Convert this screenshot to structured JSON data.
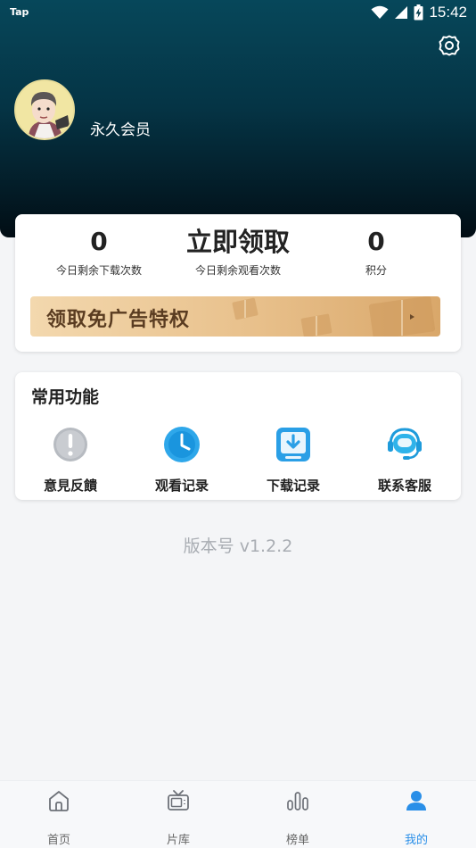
{
  "status_bar": {
    "app_label": "Tap",
    "time": "15:42"
  },
  "profile": {
    "membership": "永久会员"
  },
  "stats": {
    "download_count": "0",
    "download_label": "今日剩余下载次数",
    "claim_label": "立即领取",
    "watch_label": "今日剩余观看次数",
    "points_value": "0",
    "points_label": "积分"
  },
  "banner": {
    "text": "领取免广告特权"
  },
  "functions": {
    "title": "常用功能",
    "items": [
      {
        "label": "意見反饋",
        "icon": "exclamation-icon"
      },
      {
        "label": "观看记录",
        "icon": "clock-icon"
      },
      {
        "label": "下载记录",
        "icon": "download-icon"
      },
      {
        "label": "联系客服",
        "icon": "headset-icon"
      }
    ]
  },
  "version": "版本号 v1.2.2",
  "bottom_nav": {
    "items": [
      {
        "label": "首页",
        "icon": "home-icon"
      },
      {
        "label": "片库",
        "icon": "tv-icon"
      },
      {
        "label": "榜单",
        "icon": "bar-chart-icon"
      },
      {
        "label": "我的",
        "icon": "user-icon",
        "active": true
      }
    ]
  },
  "colors": {
    "accent": "#2a8fe8",
    "header_top": "#06475a",
    "header_bottom": "#020d14",
    "banner_text": "#5a3c21"
  }
}
